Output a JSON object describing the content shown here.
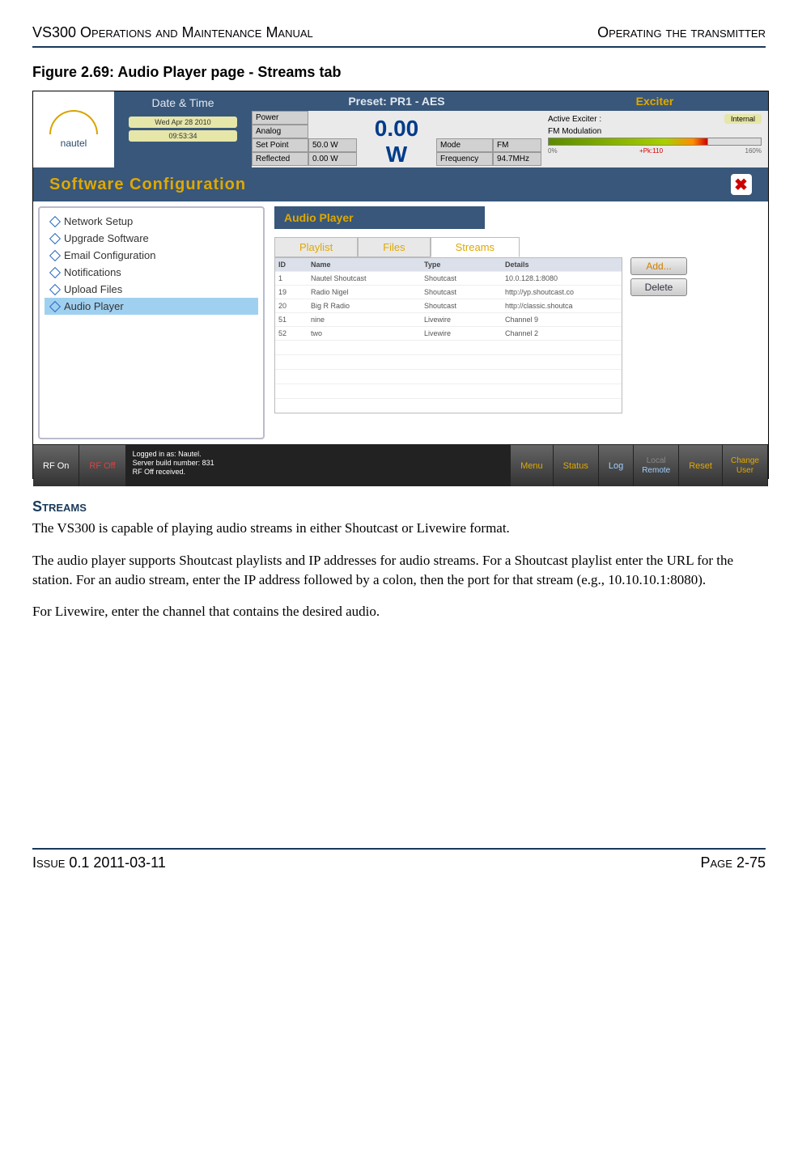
{
  "header": {
    "left": "VS300 Operations and Maintenance Manual",
    "right": "Operating the transmitter"
  },
  "figure": {
    "title": "Figure 2.69: Audio Player page - Streams tab"
  },
  "logo": {
    "brand": "nautel"
  },
  "datetime": {
    "title": "Date & Time",
    "date": "Wed Apr 28 2010",
    "time": "09:53:34"
  },
  "preset": {
    "title": "Preset: PR1 - AES",
    "big": "0.00 W",
    "rows": [
      {
        "l": "Power",
        "v": ""
      },
      {
        "l": "Analog",
        "v": ""
      },
      {
        "l": "Set Point",
        "v": "50.0 W"
      },
      {
        "l": "Reflected",
        "v": "0.00 W"
      }
    ],
    "rows2": [
      {
        "l": "Mode",
        "v": "FM"
      },
      {
        "l": "Frequency",
        "v": "94.7MHz"
      }
    ]
  },
  "exciter": {
    "title": "Exciter",
    "active_label": "Active Exciter :",
    "active_value": "Internal",
    "mod_label": "FM Modulation",
    "scale_lo": "0%",
    "scale_pk": "+Pk:110",
    "scale_hi": "160%"
  },
  "softconf": {
    "title": "Software Configuration"
  },
  "sidebar": {
    "items": [
      "Network Setup",
      "Upgrade Software",
      "Email Configuration",
      "Notifications",
      "Upload Files",
      "Audio Player"
    ]
  },
  "player": {
    "title": "Audio Player",
    "tabs": {
      "playlist": "Playlist",
      "files": "Files",
      "streams": "Streams"
    },
    "cols": {
      "id": "ID",
      "name": "Name",
      "type": "Type",
      "details": "Details"
    },
    "rows": [
      {
        "id": "1",
        "name": "Nautel Shoutcast",
        "type": "Shoutcast",
        "details": "10.0.128.1:8080"
      },
      {
        "id": "19",
        "name": "Radio Nigel",
        "type": "Shoutcast",
        "details": "http://yp.shoutcast.co"
      },
      {
        "id": "20",
        "name": "Big R Radio",
        "type": "Shoutcast",
        "details": "http://classic.shoutca"
      },
      {
        "id": "51",
        "name": "nine",
        "type": "Livewire",
        "details": "Channel 9"
      },
      {
        "id": "52",
        "name": "two",
        "type": "Livewire",
        "details": "Channel 2"
      }
    ],
    "btn_add": "Add...",
    "btn_del": "Delete"
  },
  "bottombar": {
    "rf_on": "RF On",
    "rf_off": "RF Off",
    "status_l1": "Logged in as:    Nautel.",
    "status_l2": "Server build number: 831",
    "status_l3": "RF Off received.",
    "menu": "Menu",
    "status": "Status",
    "log": "Log",
    "local": "Local",
    "remote": "Remote",
    "reset": "Reset",
    "change": "Change",
    "user": "User"
  },
  "section": {
    "title": "Streams",
    "p1": "The VS300 is capable of playing audio streams in either Shoutcast or Livewire format.",
    "p2": "The audio player supports Shoutcast playlists and IP addresses for audio streams. For a Shoutcast playlist enter the URL for the station. For an audio stream, enter the IP address followed by a colon, then the port for that stream (e.g., 10.10.10.1:8080).",
    "p3": "For Livewire, enter the channel that contains the desired audio."
  },
  "footer": {
    "left": "Issue 0.1  2011-03-11",
    "right": "Page 2-75"
  }
}
